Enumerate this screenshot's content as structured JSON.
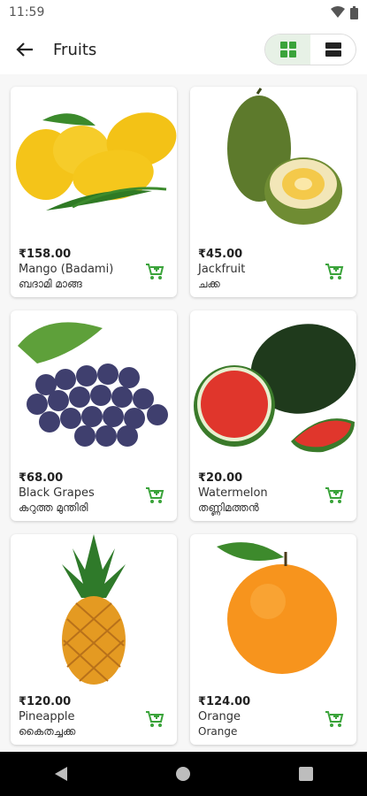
{
  "status": {
    "time": "11:59"
  },
  "appbar": {
    "title": "Fruits"
  },
  "products": [
    {
      "price": "₹158.00",
      "name": "Mango (Badami)",
      "local": "ബദാമി മാങ്ങ",
      "icon": "mango-image"
    },
    {
      "price": "₹45.00",
      "name": "Jackfruit",
      "local": "ചക്ക",
      "icon": "jackfruit-image"
    },
    {
      "price": "₹68.00",
      "name": "Black Grapes",
      "local": "കറുത്ത മുന്തിരി",
      "icon": "grapes-image"
    },
    {
      "price": "₹20.00",
      "name": "Watermelon",
      "local": "തണ്ണിമത്തൻ",
      "icon": "watermelon-image"
    },
    {
      "price": "₹120.00",
      "name": "Pineapple",
      "local": "കൈതച്ചക്ക",
      "icon": "pineapple-image"
    },
    {
      "price": "₹124.00",
      "name": "Orange",
      "local": "Orange",
      "icon": "orange-image"
    }
  ],
  "colors": {
    "accent": "#3aa33a",
    "toggle_active": "#e7f1e6"
  }
}
